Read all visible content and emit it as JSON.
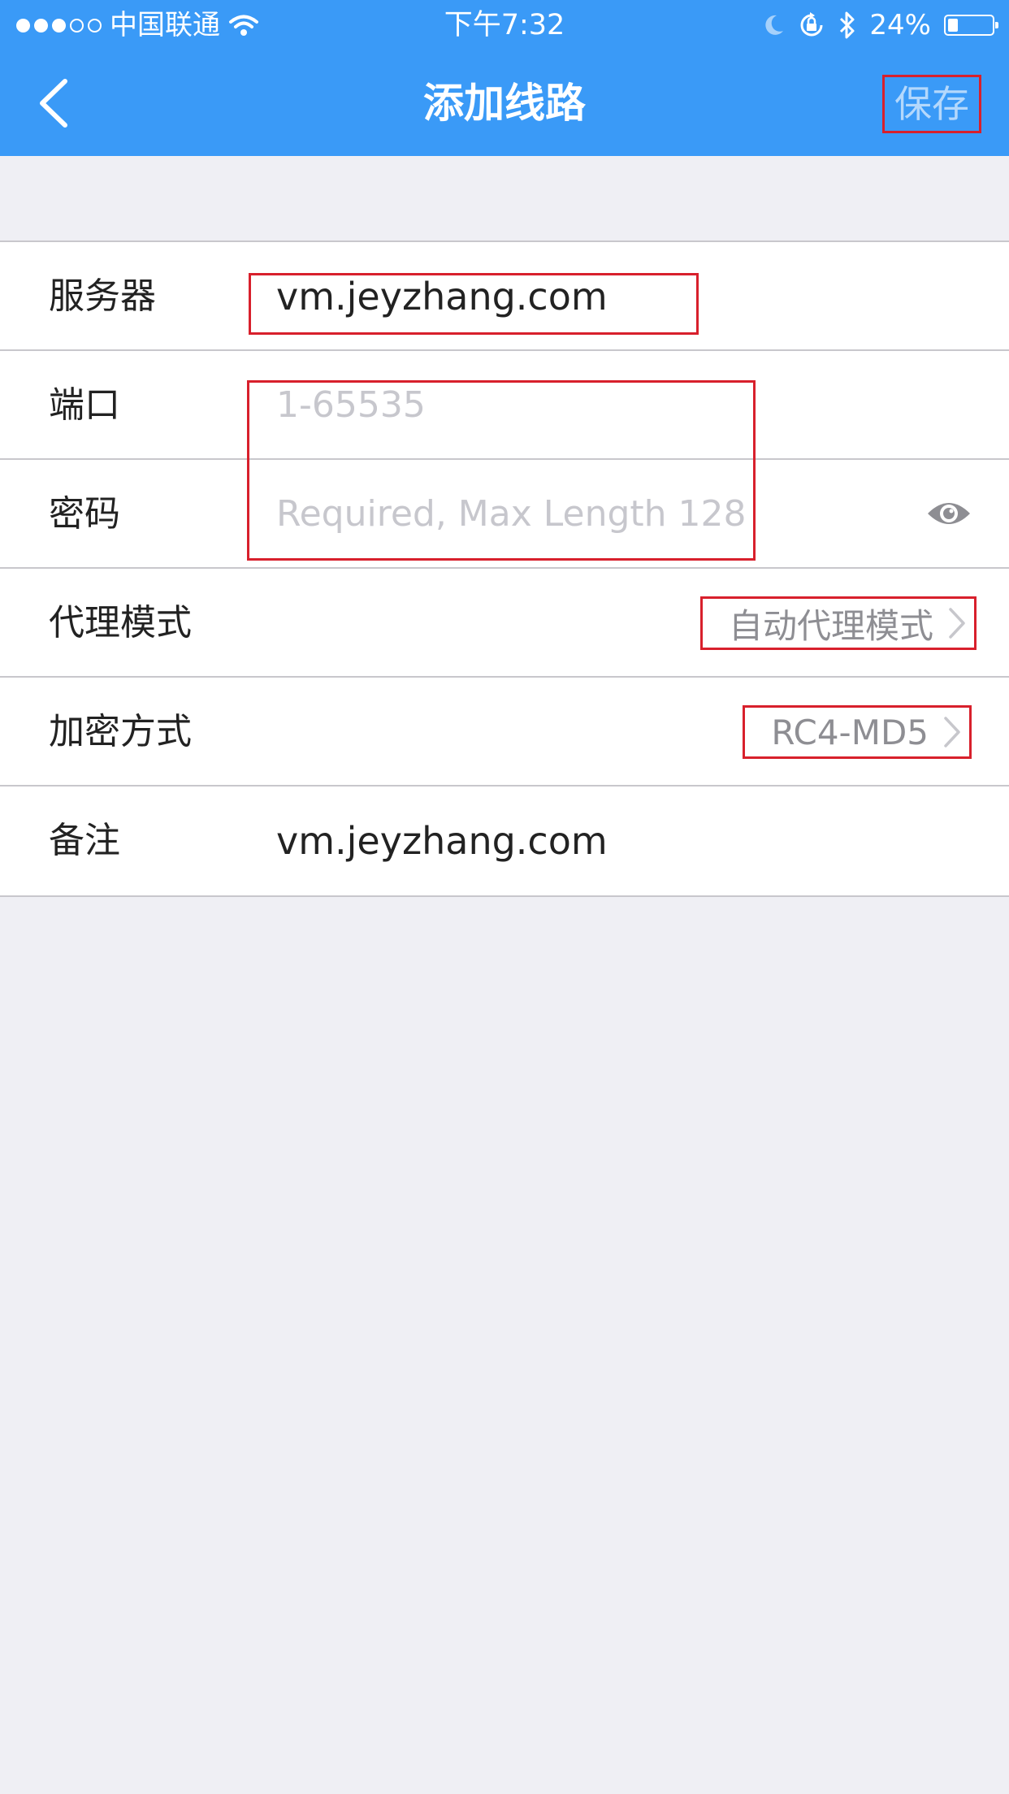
{
  "status_bar": {
    "carrier": "中国联通",
    "time": "下午7:32",
    "battery": "24%",
    "battery_level": 0.24,
    "icons": [
      "signal-dots",
      "wifi-icon",
      "moon-icon",
      "rotation-lock-icon",
      "bluetooth-icon",
      "battery-icon"
    ]
  },
  "nav": {
    "title": "添加线路",
    "save_label": "保存",
    "back_icon": "chevron-left-icon"
  },
  "form": {
    "server": {
      "label": "服务器",
      "value": "vm.jeyzhang.com"
    },
    "port": {
      "label": "端口",
      "placeholder": "1-65535"
    },
    "password": {
      "label": "密码",
      "placeholder": "Required, Max Length 128",
      "icon": "eye-icon"
    },
    "proxy_mode": {
      "label": "代理模式",
      "value": "自动代理模式"
    },
    "encryption": {
      "label": "加密方式",
      "value": "RC4-MD5"
    },
    "remark": {
      "label": "备注",
      "value": "vm.jeyzhang.com"
    }
  },
  "colors": {
    "accent": "#3a9af7",
    "highlight_box": "#d8202c",
    "background": "#efeff4"
  }
}
